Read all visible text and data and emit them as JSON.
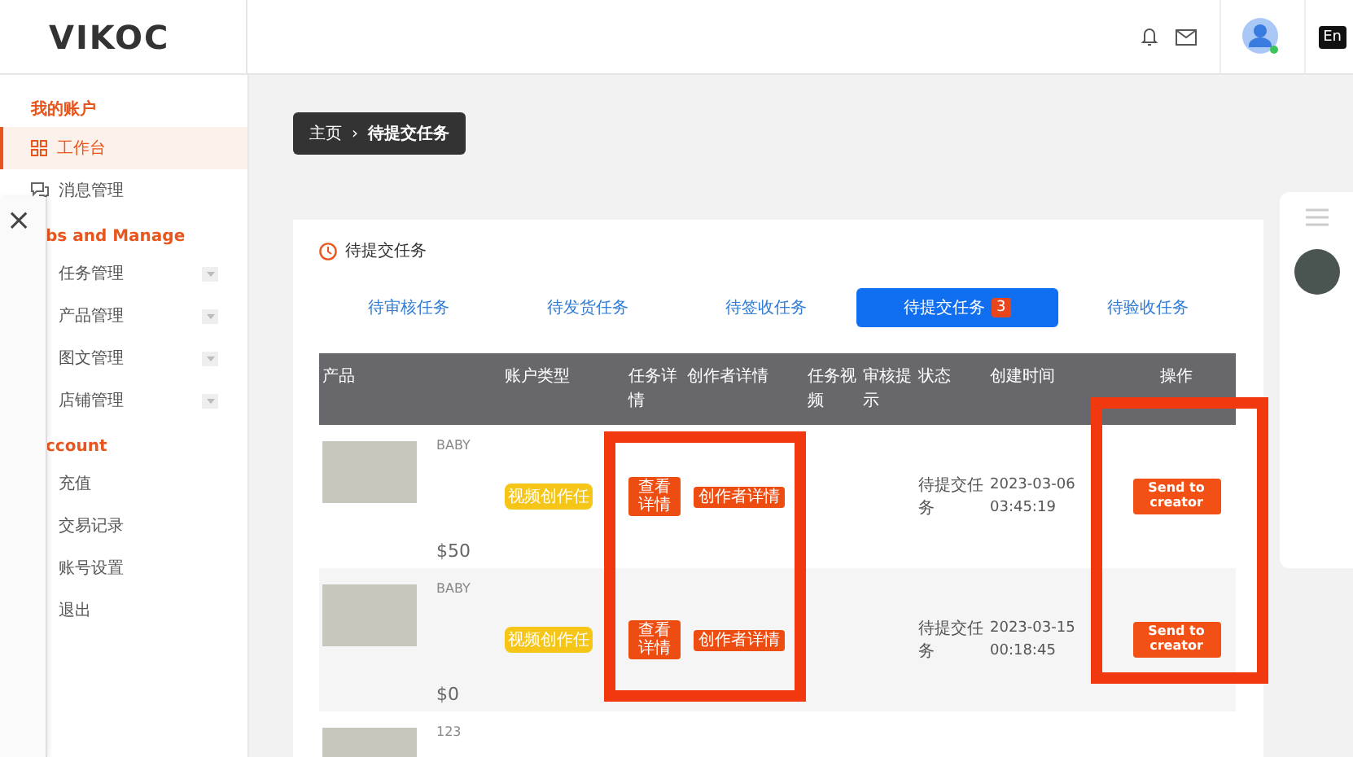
{
  "header": {
    "logo": "VIKOC",
    "language": "En"
  },
  "sidebar": {
    "sections": [
      {
        "title": "我的账户",
        "items": [
          {
            "label": "工作台",
            "selected": true,
            "expandable": false
          },
          {
            "label": "消息管理",
            "selected": false,
            "expandable": false
          }
        ]
      },
      {
        "title": "bs and Manage",
        "items": [
          {
            "label": "任务管理",
            "selected": false,
            "expandable": true
          },
          {
            "label": "产品管理",
            "selected": false,
            "expandable": true
          },
          {
            "label": "图文管理",
            "selected": false,
            "expandable": true
          },
          {
            "label": "店铺管理",
            "selected": false,
            "expandable": true
          }
        ]
      },
      {
        "title": "ccount",
        "items": [
          {
            "label": "充值",
            "selected": false,
            "expandable": false
          },
          {
            "label": "交易记录",
            "selected": false,
            "expandable": false
          },
          {
            "label": "账号设置",
            "selected": false,
            "expandable": false
          },
          {
            "label": "退出",
            "selected": false,
            "expandable": false
          }
        ]
      }
    ]
  },
  "side_panel": {
    "close": "×"
  },
  "breadcrumb": {
    "separator": "›",
    "items": [
      "主页",
      "待提交任务"
    ]
  },
  "card": {
    "title": "待提交任务",
    "tabs": [
      {
        "label": "待审核任务",
        "selected": false
      },
      {
        "label": "待发货任务",
        "selected": false
      },
      {
        "label": "待签收任务",
        "selected": false
      },
      {
        "label": "待提交任务",
        "selected": true,
        "badge": "3"
      },
      {
        "label": "待验收任务",
        "selected": false
      }
    ],
    "table": {
      "columns": [
        "产品",
        "账户类型",
        "任务详情",
        "创作者详情",
        "任务视频",
        "审核提示",
        "状态",
        "创建时间",
        "操作"
      ],
      "rows": [
        {
          "name": "BABY",
          "price": "$50",
          "account_type": "视频创作任",
          "buttons": [
            "查看详情",
            "创作者详情"
          ],
          "status": "待提交任务",
          "created": "2023-03-06 03:45:19",
          "action": "Send to creator"
        },
        {
          "name": "BABY",
          "price": "$0",
          "account_type": "视频创作任",
          "buttons": [
            "查看详情",
            "创作者详情"
          ],
          "status": "待提交任务",
          "created": "2023-03-15 00:18:45",
          "action": "Send to creator"
        },
        {
          "name": "123"
        }
      ]
    }
  }
}
